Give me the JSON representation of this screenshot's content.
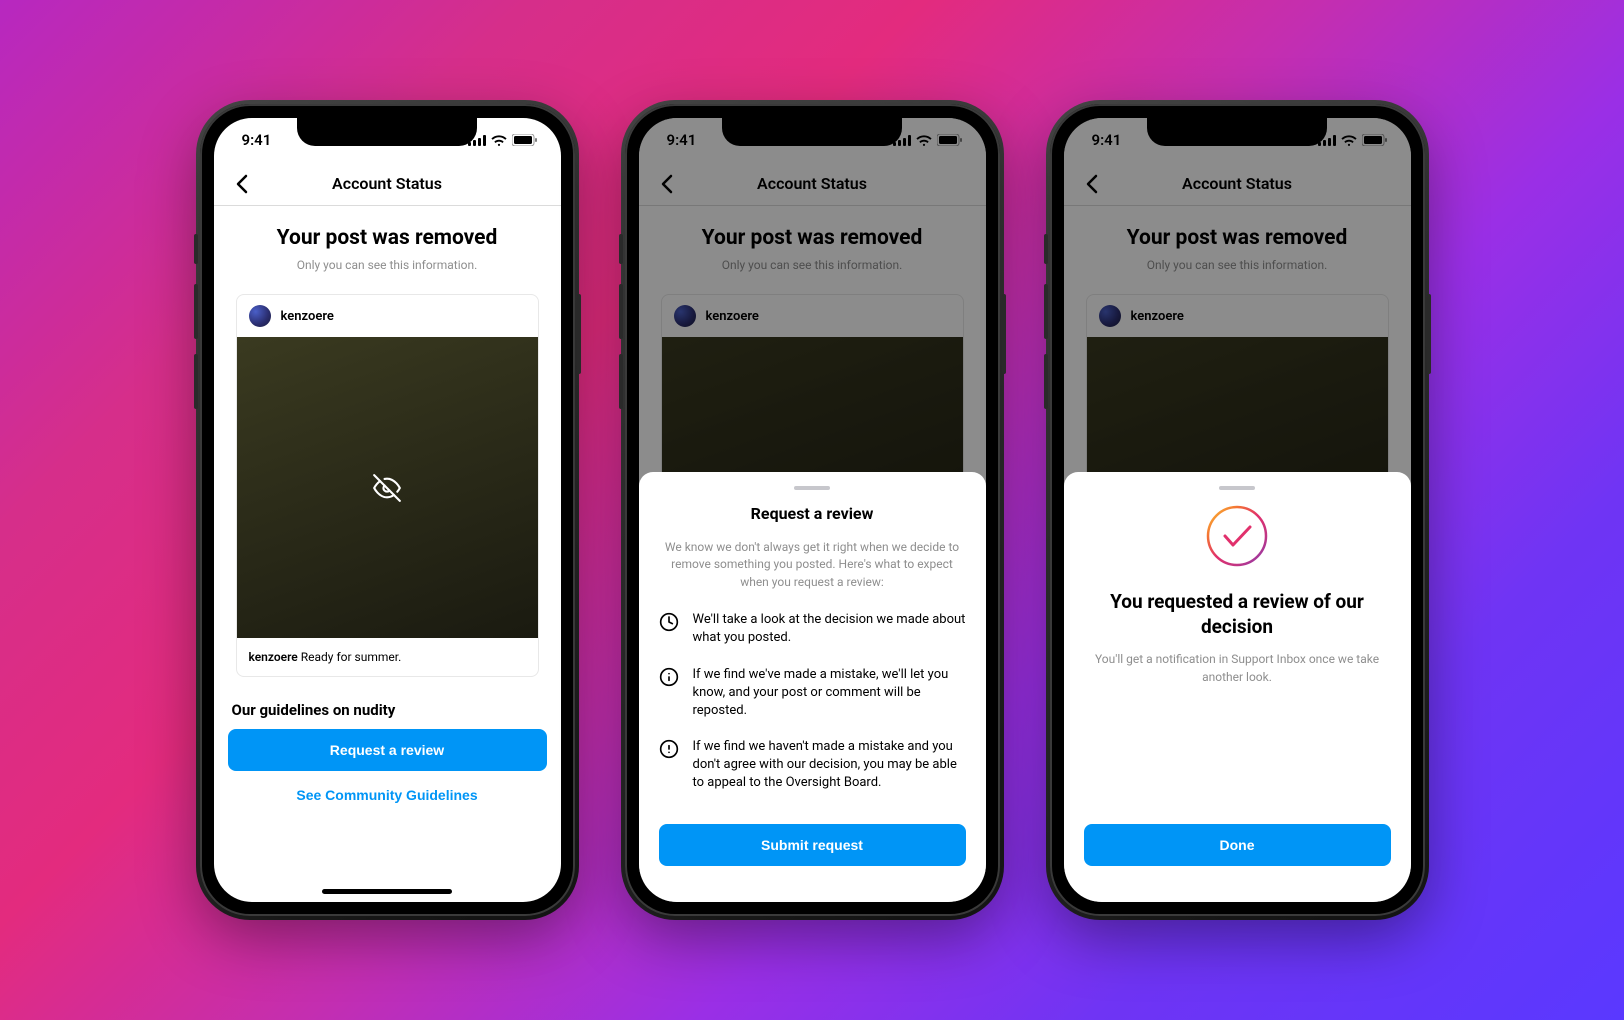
{
  "status": {
    "time": "9:41"
  },
  "nav": {
    "title": "Account Status"
  },
  "main": {
    "heading": "Your post was removed",
    "subheading": "Only you can see this information."
  },
  "post": {
    "username": "kenzoere",
    "caption_user": "kenzoere",
    "caption_text": "Ready for summer."
  },
  "guidelines_section": "Our guidelines on nudity",
  "buttons": {
    "request_review": "Request a review",
    "community_guidelines": "See Community Guidelines",
    "submit": "Submit request",
    "done": "Done"
  },
  "review_sheet": {
    "title": "Request a review",
    "intro": "We know we don't always get it right when we decide to remove something you posted. Here's what to expect when you request a review:",
    "items": [
      "We'll take a look at the decision we made about what you posted.",
      "If we find we've made a mistake, we'll let you know, and your post or comment will be reposted.",
      "If we find we haven't made a mistake and you don't agree with our decision, you may be able to appeal to the Oversight Board."
    ]
  },
  "confirm_sheet": {
    "title": "You requested a review of our decision",
    "sub": "You'll get a notification in Support Inbox once we take another look."
  }
}
